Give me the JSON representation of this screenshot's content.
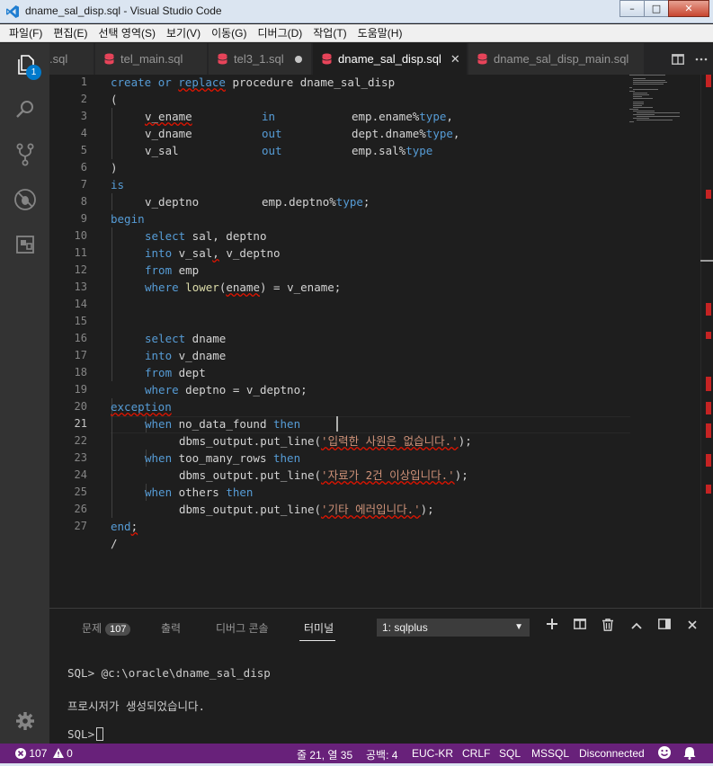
{
  "window": {
    "title": "dname_sal_disp.sql - Visual Studio Code",
    "minimize": "–",
    "maximize": "□",
    "close": "✕"
  },
  "menu": [
    "파일(F)",
    "편집(E)",
    "선택 영역(S)",
    "보기(V)",
    "이동(G)",
    "디버그(D)",
    "작업(T)",
    "도움말(H)"
  ],
  "activity": {
    "explorer_badge": "1"
  },
  "tabs": [
    {
      "label": ".sql"
    },
    {
      "label": "tel_main.sql"
    },
    {
      "label": "tel3_1.sql"
    },
    {
      "label": "dname_sal_disp.sql",
      "close": "✕"
    },
    {
      "label": "dname_sal_disp_main.sql"
    }
  ],
  "editor": {
    "line_numbers": [
      "1",
      "2",
      "3",
      "4",
      "5",
      "6",
      "7",
      "8",
      "9",
      "10",
      "11",
      "12",
      "13",
      "14",
      "15",
      "16",
      "17",
      "18",
      "19",
      "20",
      "21",
      "22",
      "23",
      "24",
      "25",
      "26",
      "27"
    ],
    "tokens": {
      "l1_create": "create",
      "l1_or": "or",
      "l1_replace": "replace",
      "l1_rest": " procedure dname_sal_disp",
      "l2": "(",
      "l3_name": "v_ename",
      "l3_mode": "in",
      "l3_type_a": "emp.ename%",
      "l3_type_b": "type",
      "l3_type_c": ",",
      "l4_name": "v_dname",
      "l4_mode": "out",
      "l4_type_a": "dept.dname%",
      "l4_type_b": "type",
      "l4_type_c": ",",
      "l5_name": "v_sal",
      "l5_mode": "out",
      "l5_type_a": "emp.sal%",
      "l5_type_b": "type",
      "l6": ")",
      "l7": "is",
      "l8_name": "v_deptno",
      "l8_type_a": "emp.deptno%",
      "l8_type_b": "type",
      "l8_type_c": ";",
      "l9": "begin",
      "l10_kw": "select",
      "l10_rest": " sal, deptno",
      "l11_kw": "into",
      "l11_a": " v_sal",
      "l11_b": ",",
      "l11_c": " v_deptno",
      "l12_kw": "from",
      "l12_rest": " emp",
      "l13_kw": "where",
      "l13_fn": "lower",
      "l13_a": "(",
      "l13_b": "ename",
      "l13_c": ") = v_ename;",
      "l15_kw": "select",
      "l15_rest": " dname",
      "l16_kw": "into",
      "l16_rest": " v_dname",
      "l17_kw": "from",
      "l17_rest": " dept",
      "l18_kw": "where",
      "l18_rest": " deptno = v_deptno;",
      "l19": "exception",
      "l20_kw": "when",
      "l20_rest": " no_data_found ",
      "l20_then": "then",
      "l21_a": "dbms_output.put_line(",
      "l21_str": "'입력한 사원은 없습니다.'",
      "l21_c": ");",
      "l22_kw": "when",
      "l22_rest": " too_many_rows ",
      "l22_then": "then",
      "l23_a": "dbms_output.put_line(",
      "l23_str": "'자료가 2건 이상입니다.'",
      "l23_c": ");",
      "l24_kw": "when",
      "l24_rest": " others ",
      "l24_then": "then",
      "l25_a": "dbms_output.put_line(",
      "l25_str": "'기타 에러입니다.'",
      "l25_c": ");",
      "l26_a": "end",
      "l26_b": ";",
      "l27": "/"
    }
  },
  "panel": {
    "problems_label": "문제",
    "problems_count": "107",
    "output_label": "출력",
    "debug_console_label": "디버그 콘솔",
    "terminal_label": "터미널",
    "terminal_select": "1: sqlplus",
    "terminal_lines": {
      "prompt1": "SQL> @c:\\oracle\\dname_sal_disp",
      "result": "프로시저가 생성되었습니다.",
      "prompt2": "SQL>"
    }
  },
  "status": {
    "errors": "107",
    "warnings": "0",
    "position": "줄 21, 열 35",
    "indent": "공백: 4",
    "encoding": "EUC-KR",
    "eol": "CRLF",
    "language": "SQL",
    "dialect": "MSSQL",
    "connection": "Disconnected"
  },
  "colors": {
    "status_bar": "#68217a",
    "activity_bar": "#333333",
    "editor_bg": "#1e1e1e",
    "keyword": "#569cd6",
    "string": "#ce9178",
    "function": "#dcdcaa",
    "badge": "#007acc"
  }
}
